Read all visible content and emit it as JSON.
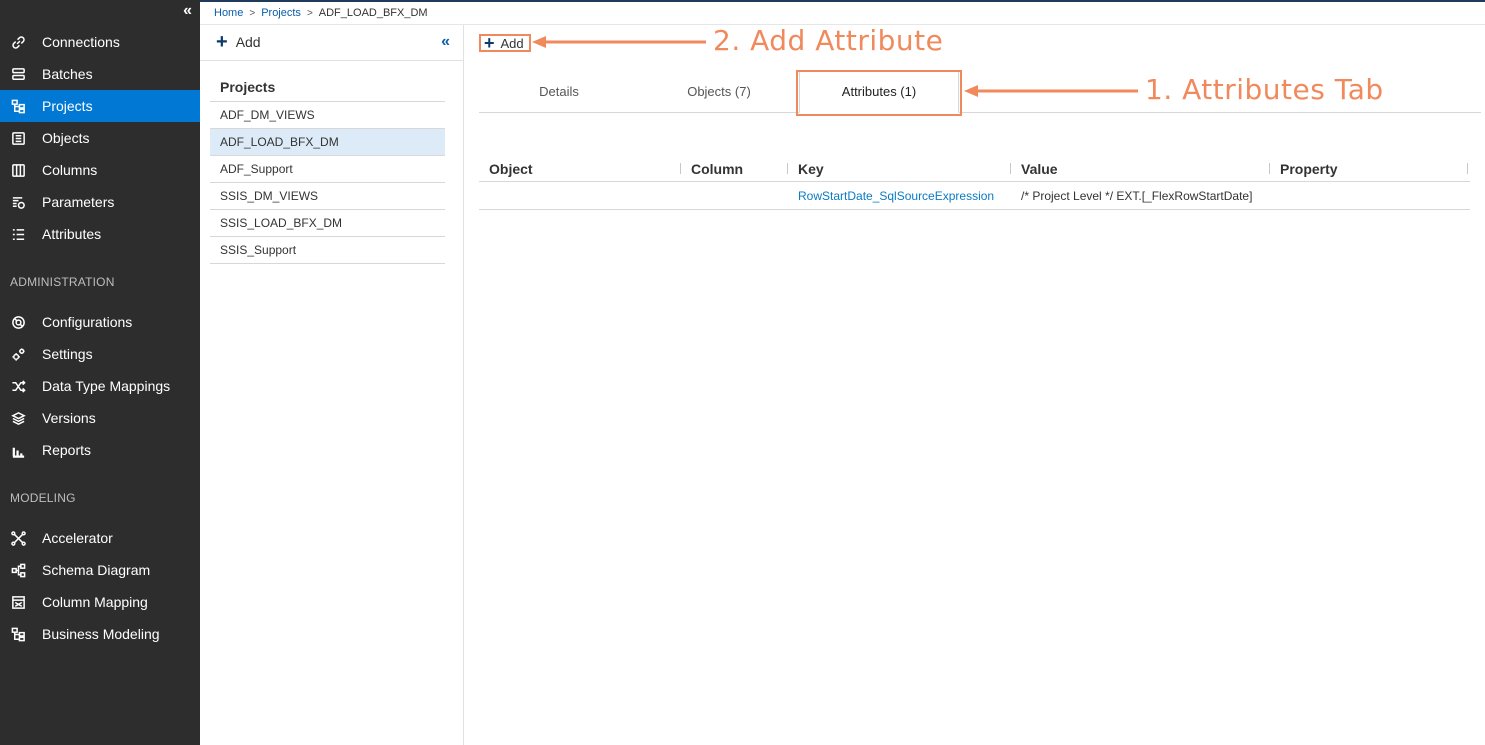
{
  "sidebar": {
    "collapse_glyph": "«",
    "nav_main": [
      {
        "label": "Connections",
        "icon": "link-icon"
      },
      {
        "label": "Batches",
        "icon": "batches-icon"
      },
      {
        "label": "Projects",
        "icon": "projects-icon",
        "active": true
      },
      {
        "label": "Objects",
        "icon": "objects-icon"
      },
      {
        "label": "Columns",
        "icon": "columns-icon"
      },
      {
        "label": "Parameters",
        "icon": "parameters-icon"
      },
      {
        "label": "Attributes",
        "icon": "attributes-icon"
      }
    ],
    "section_admin": "ADMINISTRATION",
    "nav_admin": [
      {
        "label": "Configurations",
        "icon": "configurations-icon"
      },
      {
        "label": "Settings",
        "icon": "settings-icon"
      },
      {
        "label": "Data Type Mappings",
        "icon": "shuffle-icon"
      },
      {
        "label": "Versions",
        "icon": "layers-icon"
      },
      {
        "label": "Reports",
        "icon": "bar-chart-icon"
      }
    ],
    "section_modeling": "MODELING",
    "nav_modeling": [
      {
        "label": "Accelerator",
        "icon": "accelerator-icon"
      },
      {
        "label": "Schema Diagram",
        "icon": "schema-icon"
      },
      {
        "label": "Column Mapping",
        "icon": "column-mapping-icon"
      },
      {
        "label": "Business Modeling",
        "icon": "business-modeling-icon"
      }
    ]
  },
  "breadcrumb": {
    "home": "Home",
    "projects": "Projects",
    "current": "ADF_LOAD_BFX_DM",
    "separator": ">"
  },
  "projects_panel": {
    "add_label": "Add",
    "collapse_glyph": "«",
    "title": "Projects",
    "items": [
      "ADF_DM_VIEWS",
      "ADF_LOAD_BFX_DM",
      "ADF_Support",
      "SSIS_DM_VIEWS",
      "SSIS_LOAD_BFX_DM",
      "SSIS_Support"
    ],
    "selected_index": 1
  },
  "main": {
    "add_label": "Add",
    "tabs": [
      {
        "label": "Details"
      },
      {
        "label": "Objects (7)"
      },
      {
        "label": "Attributes (1)",
        "active": true
      }
    ],
    "grid": {
      "columns": [
        "Object",
        "Column",
        "Key",
        "Value",
        "Property"
      ],
      "rows": [
        {
          "object": "",
          "column": "",
          "key": "RowStartDate_SqlSourceExpression",
          "value": "/* Project Level */ EXT.[_FlexRowStartDate]",
          "property": ""
        }
      ]
    }
  },
  "annotations": {
    "add_attribute": "2. Add Attribute",
    "attributes_tab": "1. Attributes Tab"
  },
  "colors": {
    "sidebar_bg": "#2d2d2d",
    "active_nav": "#0078d4",
    "annotation": "#f08a5d",
    "link": "#0b7bc4"
  }
}
